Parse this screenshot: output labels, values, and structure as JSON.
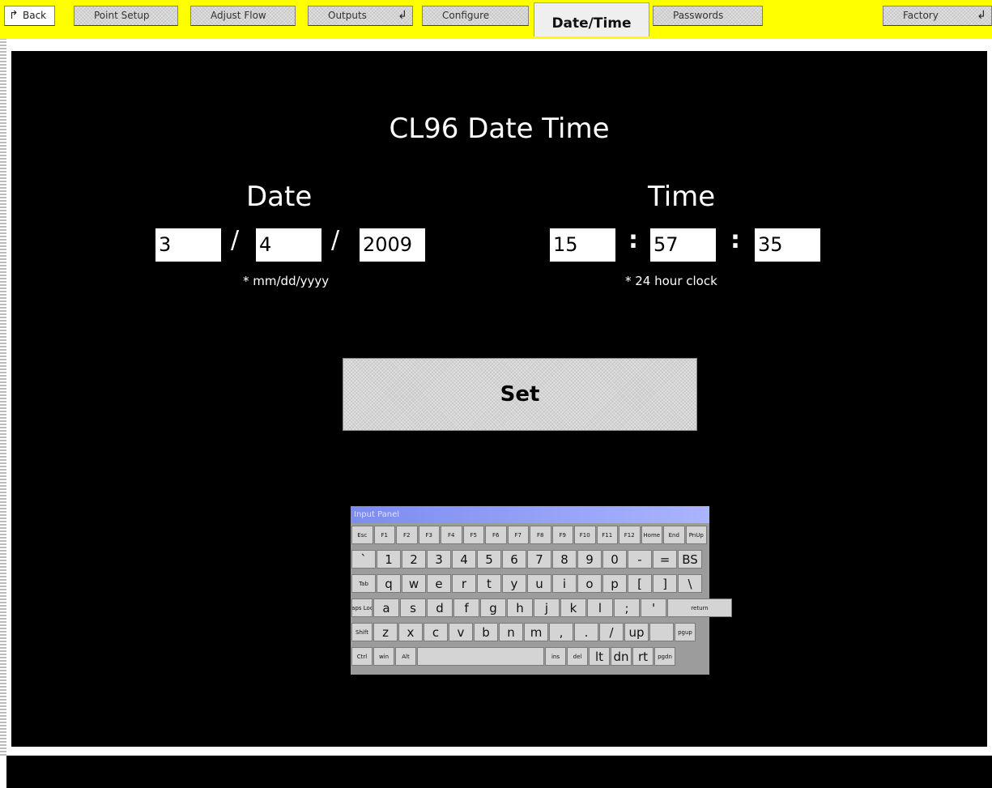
{
  "tabs": [
    {
      "label": "Back",
      "name": "tab-back",
      "arrow": ""
    },
    {
      "label": "Point Setup",
      "name": "tab-point-setup",
      "arrow": ""
    },
    {
      "label": "Adjust Flow",
      "name": "tab-adjust-flow",
      "arrow": ""
    },
    {
      "label": "Outputs",
      "name": "tab-outputs",
      "arrow": "↲"
    },
    {
      "label": "Configure",
      "name": "tab-configure",
      "arrow": ""
    },
    {
      "label": "Passwords",
      "name": "tab-passwords",
      "arrow": ""
    },
    {
      "label": "Factory",
      "name": "tab-factory",
      "arrow": "↲"
    }
  ],
  "active_tab": "Date/Time",
  "title": "CL96 Date Time",
  "date": {
    "heading": "Date",
    "month": "3",
    "day": "4",
    "year": "2009",
    "separator": "/",
    "hint": "*  mm/dd/yyyy"
  },
  "time": {
    "heading": "Time",
    "hour": "15",
    "minute": "57",
    "second": "35",
    "separator": ":",
    "hint": "* 24 hour clock"
  },
  "set_button": "Set",
  "keyboard": {
    "title": "Input Panel",
    "rows": [
      [
        "Esc",
        "F1",
        "F2",
        "F3",
        "F4",
        "F5",
        "F6",
        "F7",
        "F8",
        "F9",
        "F10",
        "F11",
        "F12",
        "Home",
        "End",
        "PnUp"
      ],
      [
        "`",
        "1",
        "2",
        "3",
        "4",
        "5",
        "6",
        "7",
        "8",
        "9",
        "0",
        "-",
        "=",
        "BS"
      ],
      [
        "Tab",
        "q",
        "w",
        "e",
        "r",
        "t",
        "y",
        "u",
        "i",
        "o",
        "p",
        "[",
        "]",
        "\\"
      ],
      [
        "Caps Lock",
        "a",
        "s",
        "d",
        "f",
        "g",
        "h",
        "j",
        "k",
        "l",
        ";",
        "'",
        "return"
      ],
      [
        "Shift",
        "z",
        "x",
        "c",
        "v",
        "b",
        "n",
        "m",
        ",",
        ".",
        "/",
        "up",
        "",
        "pgup"
      ],
      [
        "Ctrl",
        "win",
        "Alt",
        "",
        "ins",
        "del",
        "lt",
        "dn",
        "rt",
        "pgdn"
      ]
    ]
  },
  "colors": {
    "tab_bar": "#ffff00",
    "screen": "#000000",
    "text": "#ffffff"
  }
}
